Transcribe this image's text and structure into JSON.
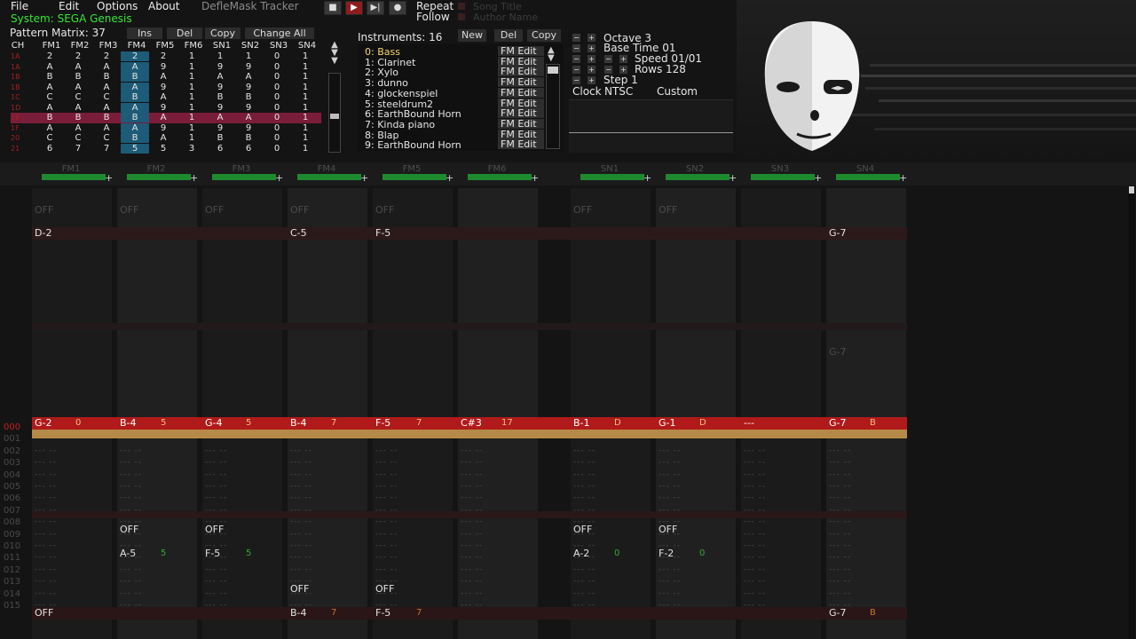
{
  "menu": {
    "file": "File",
    "edit": "Edit",
    "options": "Options",
    "about": "About"
  },
  "app_title": "DefleMask Tracker",
  "system": "System: SEGA Genesis",
  "transport": {
    "stop_icon": "stop-icon",
    "play_icon": "play-icon",
    "step_icon": "step-forward-icon",
    "record_icon": "record-icon",
    "repeat": "Repeat",
    "follow": "Follow",
    "song_title": "Song Title",
    "author_name": "Author Name"
  },
  "pattern_matrix": {
    "label": "Pattern Matrix: 37",
    "ins_label": "Ins",
    "del_label": "Del",
    "copy_label": "Copy",
    "change_all_label": "Change All",
    "headers": [
      "CH",
      "FM1",
      "FM2",
      "FM3",
      "FM4",
      "FM5",
      "FM6",
      "SN1",
      "SN2",
      "SN3",
      "SN4"
    ],
    "rows": [
      {
        "num": "1A",
        "cells": [
          "2",
          "2",
          "2",
          "2",
          "2",
          "1",
          "1",
          "1",
          "0",
          "1"
        ],
        "selected": false
      },
      {
        "num": "1A",
        "cells": [
          "A",
          "A",
          "A",
          "A",
          "9",
          "1",
          "9",
          "9",
          "0",
          "1"
        ],
        "selected": false
      },
      {
        "num": "1B",
        "cells": [
          "B",
          "B",
          "B",
          "B",
          "A",
          "1",
          "A",
          "A",
          "0",
          "1"
        ],
        "selected": false
      },
      {
        "num": "1B",
        "cells": [
          "A",
          "A",
          "A",
          "A",
          "9",
          "1",
          "9",
          "9",
          "0",
          "1"
        ],
        "selected": false
      },
      {
        "num": "1C",
        "cells": [
          "C",
          "C",
          "C",
          "B",
          "A",
          "1",
          "B",
          "B",
          "0",
          "1"
        ],
        "selected": false
      },
      {
        "num": "1D",
        "cells": [
          "A",
          "A",
          "A",
          "A",
          "9",
          "1",
          "9",
          "9",
          "0",
          "1"
        ],
        "selected": false
      },
      {
        "num": "1E",
        "cells": [
          "B",
          "B",
          "B",
          "B",
          "A",
          "1",
          "A",
          "A",
          "0",
          "1"
        ],
        "selected": true
      },
      {
        "num": "1F",
        "cells": [
          "A",
          "A",
          "A",
          "A",
          "9",
          "1",
          "9",
          "9",
          "0",
          "1"
        ],
        "selected": false
      },
      {
        "num": "20",
        "cells": [
          "C",
          "C",
          "C",
          "B",
          "A",
          "1",
          "B",
          "B",
          "0",
          "1"
        ],
        "selected": false
      },
      {
        "num": "21",
        "cells": [
          "6",
          "7",
          "7",
          "5",
          "5",
          "3",
          "6",
          "6",
          "0",
          "1"
        ],
        "selected": false
      }
    ]
  },
  "instruments": {
    "label": "Instruments: 16",
    "new_label": "New",
    "del_label": "Del",
    "copy_label": "Copy",
    "items": [
      "0: Bass",
      "1: Clarinet",
      "2: Xylo",
      "3: dunno",
      "4: glockenspiel",
      "5: steeldrum2",
      "6: EarthBound Horn",
      "7: Kinda piano",
      "8: Blap",
      "9: EarthBound Horn"
    ],
    "edit_label": "FM Edit"
  },
  "settings": {
    "octave": "Octave 3",
    "base_time": "Base Time 01",
    "speed": "Speed 01/01",
    "rows": "Rows 128",
    "step": "Step 1",
    "clock_label": "Clock",
    "clock_value": "NTSC",
    "custom": "Custom"
  },
  "channels": [
    "FM1",
    "FM2",
    "FM3",
    "FM4",
    "FM5",
    "FM6",
    "SN1",
    "SN2",
    "SN3",
    "SN4"
  ],
  "pattern": {
    "row_numbers": [
      "000",
      "001",
      "002",
      "003",
      "004",
      "005",
      "006",
      "007",
      "008",
      "009",
      "010",
      "011",
      "012",
      "013",
      "014",
      "015"
    ],
    "top_row": [
      "D-2",
      "",
      "",
      "C-5",
      "F-5",
      "",
      "",
      "",
      "",
      "G-7"
    ],
    "current_notes": [
      {
        "note": "G-2",
        "inst": "0"
      },
      {
        "note": "B-4",
        "inst": "5"
      },
      {
        "note": "G-4",
        "inst": "5"
      },
      {
        "note": "B-4",
        "inst": "7"
      },
      {
        "note": "F-5",
        "inst": "7"
      },
      {
        "note": "C#3",
        "inst": "17"
      },
      {
        "note": "B-1",
        "inst": "D"
      },
      {
        "note": "G-1",
        "inst": "D"
      },
      {
        "note": "---",
        "inst": ""
      },
      {
        "note": "G-7",
        "inst": "B"
      }
    ],
    "off_label": "OFF",
    "row11_notes": [
      "",
      "A-5",
      "F-5",
      "",
      "",
      "",
      "A-2",
      "F-2",
      "",
      ""
    ],
    "row11_inst": [
      "",
      "5",
      "5",
      "",
      "",
      "",
      "0",
      "0",
      "",
      ""
    ],
    "bottom_notes": [
      "OFF",
      "",
      "",
      "B-4",
      "F-5",
      "",
      "",
      "",
      "",
      "G-7"
    ],
    "bottom_inst": [
      "",
      "",
      "",
      "7",
      "7",
      "",
      "",
      "",
      "",
      "B"
    ],
    "ghost_g7": "G-7"
  }
}
